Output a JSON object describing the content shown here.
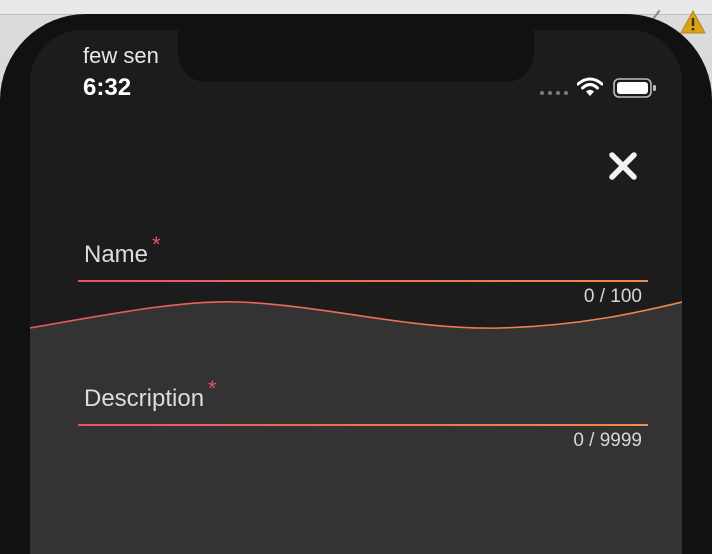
{
  "status_bar": {
    "carrier": "few sen",
    "time": "6:32"
  },
  "icons": {
    "close": "close-icon",
    "wifi": "wifi-icon",
    "battery": "battery-icon",
    "signal": "signal-dots-icon",
    "warning": "warning-icon"
  },
  "colors": {
    "background_top": "#1c1c1c",
    "background_bottom": "#333333",
    "accent_start": "#e8545e",
    "accent_end": "#f08a4b",
    "required": "#e8545e",
    "text": "#dcdcdc"
  },
  "form": {
    "name": {
      "label": "Name",
      "required_mark": "*",
      "value": "",
      "counter": "0 / 100"
    },
    "description": {
      "label": "Description",
      "required_mark": "*",
      "value": "",
      "counter": "0 / 9999"
    }
  }
}
